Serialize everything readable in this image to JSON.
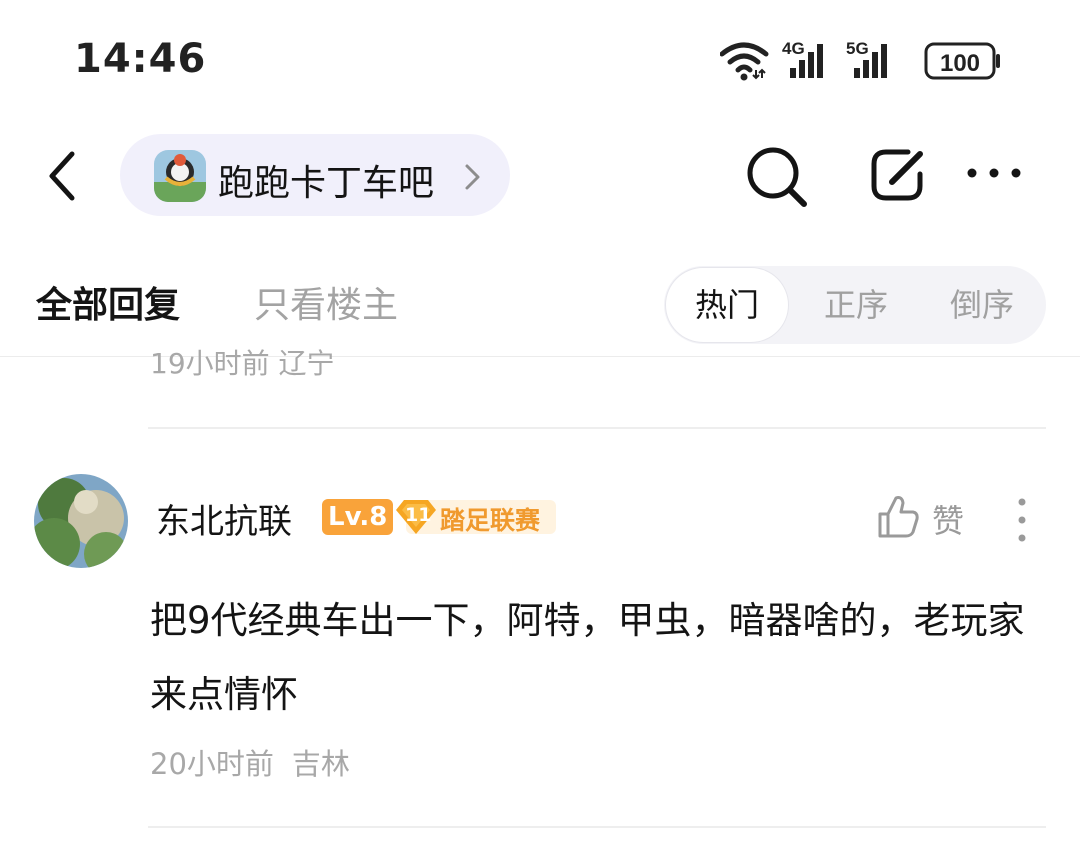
{
  "status_bar": {
    "time": "14:46",
    "network_1": "4G",
    "network_2": "5G",
    "battery": "100"
  },
  "nav": {
    "forum_name": "跑跑卡丁车吧",
    "icons": [
      "back-icon",
      "chevron-right-icon",
      "search-icon",
      "edit-icon",
      "more-horizontal-icon"
    ]
  },
  "tabs": {
    "all_replies": "全部回复",
    "op_only": "只看楼主",
    "sort_options": [
      "热门",
      "正序",
      "倒序"
    ],
    "active_sort": "热门"
  },
  "previous_meta": "19小时前 辽宁",
  "reply": {
    "username": "东北抗联",
    "level": "Lv.8",
    "league_number": "11",
    "league_name": "踏足联赛",
    "like_label": "赞",
    "text": "把9代经典车出一下，阿特，甲虫，暗器啥的，老玩家来点情怀",
    "time": "20小时前",
    "location": "吉林"
  },
  "colors": {
    "pill_bg": "#f1f0fb",
    "level_badge": "#f9a33a",
    "league_text": "#f09a2e",
    "muted_text": "#a8a8a8"
  }
}
